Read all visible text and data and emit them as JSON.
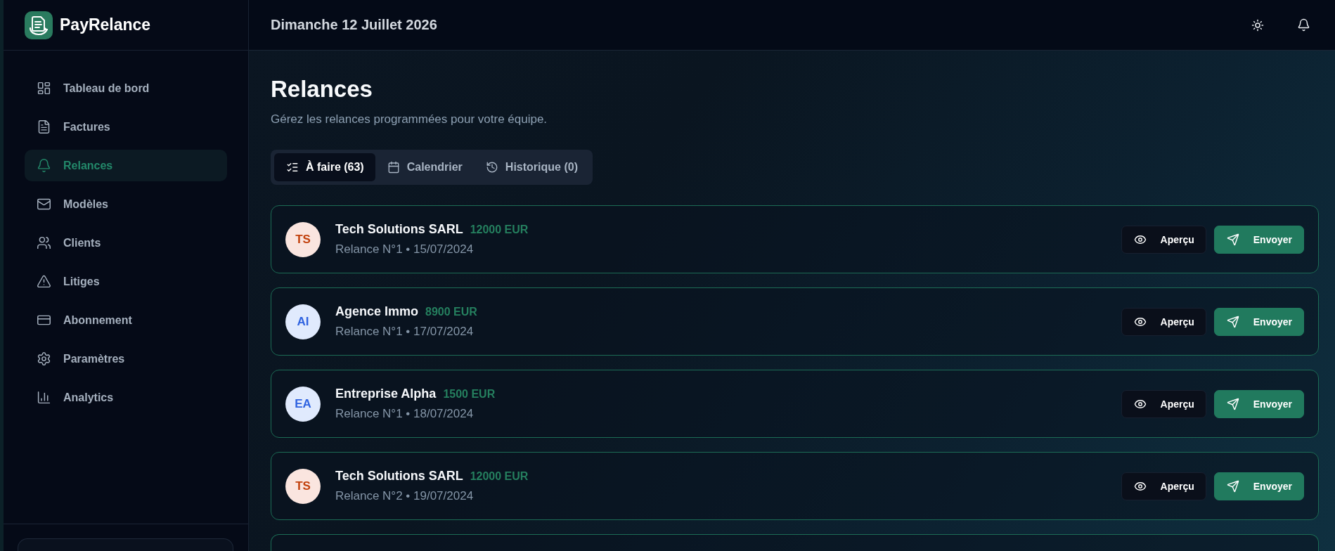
{
  "brand": {
    "name": "PayRelance"
  },
  "sidebar": {
    "items": [
      {
        "label": "Tableau de bord",
        "selected": false
      },
      {
        "label": "Factures",
        "selected": false
      },
      {
        "label": "Relances",
        "selected": true
      },
      {
        "label": "Modèles",
        "selected": false
      },
      {
        "label": "Clients",
        "selected": false
      },
      {
        "label": "Litiges",
        "selected": false
      },
      {
        "label": "Abonnement",
        "selected": false
      },
      {
        "label": "Paramètres",
        "selected": false
      },
      {
        "label": "Analytics",
        "selected": false
      }
    ]
  },
  "header": {
    "date": "Dimanche 12 Juillet 2026"
  },
  "page": {
    "title": "Relances",
    "subtitle": "Gérez les relances programmées pour votre équipe."
  },
  "tabs": [
    {
      "label": "À faire (63)",
      "selected": true
    },
    {
      "label": "Calendrier",
      "selected": false
    },
    {
      "label": "Historique (0)",
      "selected": false
    }
  ],
  "reminders": [
    {
      "initials": "TS",
      "color": "#c2410c",
      "client": "Tech Solutions SARL",
      "amount": "12000 EUR",
      "detail": "Relance N°1 • 15/07/2024",
      "buttons": [
        {
          "label": "Aperçu",
          "kind": "preview"
        },
        {
          "label": "Envoyer",
          "kind": "send"
        }
      ]
    },
    {
      "initials": "AI",
      "color": "#2f63e0",
      "client": "Agence Immo",
      "amount": "8900 EUR",
      "detail": "Relance N°1 • 17/07/2024",
      "buttons": [
        {
          "label": "Aperçu",
          "kind": "preview"
        },
        {
          "label": "Envoyer",
          "kind": "send"
        }
      ]
    },
    {
      "initials": "EA",
      "color": "#2f63e0",
      "client": "Entreprise Alpha",
      "amount": "1500 EUR",
      "detail": "Relance N°1 • 18/07/2024",
      "buttons": [
        {
          "label": "Aperçu",
          "kind": "preview"
        },
        {
          "label": "Envoyer",
          "kind": "send"
        }
      ]
    },
    {
      "initials": "TS",
      "color": "#c2410c",
      "client": "Tech Solutions SARL",
      "amount": "12000 EUR",
      "detail": "Relance N°2 • 19/07/2024",
      "buttons": [
        {
          "label": "Aperçu",
          "kind": "preview"
        },
        {
          "label": "Envoyer",
          "kind": "send"
        }
      ]
    }
  ]
}
